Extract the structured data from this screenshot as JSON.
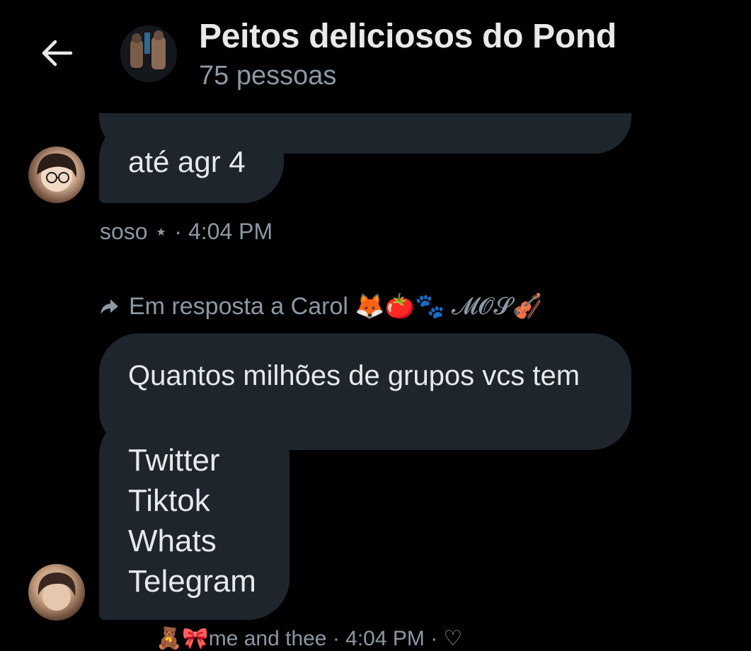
{
  "header": {
    "title": "Peitos deliciosos do Pond",
    "subtitle": "75 pessoas",
    "back_icon": "arrow-left-icon"
  },
  "messages": [
    {
      "text": "até agr 4",
      "author": "soso",
      "author_suffix": "⋆",
      "time": "4:04 PM",
      "meta": "soso ⋆ · 4:04 PM"
    },
    {
      "reply_to": "Em resposta a Carol 🦊🍅🐾 𝓜𝓞𝓢🎻",
      "text": "Quantos milhões de grupos vcs tem"
    },
    {
      "lines": [
        "Twitter",
        "Tiktok",
        "Whats",
        "Telegram"
      ]
    }
  ],
  "footer_meta": "🧸🎀me and thee · 4:04 PM · ♡",
  "colors": {
    "background": "#000000",
    "bubble": "#1e252d",
    "text": "#e7e9ea",
    "muted": "#8b98a5"
  }
}
